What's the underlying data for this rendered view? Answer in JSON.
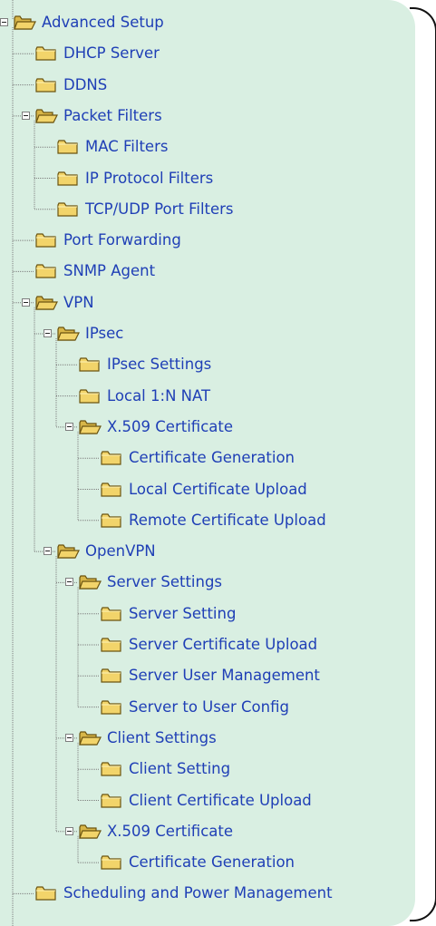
{
  "tree": [
    {
      "id": "advanced-setup",
      "label": "Advanced Setup",
      "level": 0,
      "open": true
    },
    {
      "id": "dhcp-server",
      "label": "DHCP Server",
      "level": 1
    },
    {
      "id": "ddns",
      "label": "DDNS",
      "level": 1
    },
    {
      "id": "packet-filters",
      "label": "Packet Filters",
      "level": 1,
      "open": true
    },
    {
      "id": "mac-filters",
      "label": "MAC Filters",
      "level": 2
    },
    {
      "id": "ip-protocol-filters",
      "label": "IP Protocol Filters",
      "level": 2
    },
    {
      "id": "tcp-udp-port-filters",
      "label": "TCP/UDP Port Filters",
      "level": 2
    },
    {
      "id": "port-forwarding",
      "label": "Port Forwarding",
      "level": 1
    },
    {
      "id": "snmp-agent",
      "label": "SNMP Agent",
      "level": 1
    },
    {
      "id": "vpn",
      "label": "VPN",
      "level": 1,
      "open": true
    },
    {
      "id": "ipsec",
      "label": "IPsec",
      "level": 2,
      "open": true
    },
    {
      "id": "ipsec-settings",
      "label": "IPsec Settings",
      "level": 3
    },
    {
      "id": "local-1n-nat",
      "label": "Local 1:N NAT",
      "level": 3
    },
    {
      "id": "x509-certificate-ipsec",
      "label": "X.509 Certificate",
      "level": 3,
      "open": true
    },
    {
      "id": "certificate-generation-ipsec",
      "label": "Certificate Generation",
      "level": 4
    },
    {
      "id": "local-certificate-upload",
      "label": "Local Certificate Upload",
      "level": 4
    },
    {
      "id": "remote-certificate-upload",
      "label": "Remote Certificate Upload",
      "level": 4
    },
    {
      "id": "openvpn",
      "label": "OpenVPN",
      "level": 2,
      "open": true
    },
    {
      "id": "server-settings",
      "label": "Server Settings",
      "level": 3,
      "open": true
    },
    {
      "id": "server-setting",
      "label": "Server Setting",
      "level": 4
    },
    {
      "id": "server-certificate-upload",
      "label": "Server Certificate Upload",
      "level": 4
    },
    {
      "id": "server-user-management",
      "label": "Server User Management",
      "level": 4
    },
    {
      "id": "server-to-user-config",
      "label": "Server to User Config",
      "level": 4
    },
    {
      "id": "client-settings",
      "label": "Client Settings",
      "level": 3,
      "open": true
    },
    {
      "id": "client-setting",
      "label": "Client Setting",
      "level": 4
    },
    {
      "id": "client-certificate-upload",
      "label": "Client Certificate Upload",
      "level": 4
    },
    {
      "id": "x509-certificate-openvpn",
      "label": "X.509 Certificate",
      "level": 3,
      "open": true
    },
    {
      "id": "certificate-generation-openvpn",
      "label": "Certificate Generation",
      "level": 4
    },
    {
      "id": "scheduling-and-power-management",
      "label": "Scheduling and Power Management",
      "level": 1
    }
  ],
  "colors": {
    "panel_bg": "#d9efe2",
    "link": "#1f3fb6",
    "connector": "#7d7d7d",
    "folder_fill": "#f2d46a",
    "folder_stroke": "#6b5410"
  }
}
